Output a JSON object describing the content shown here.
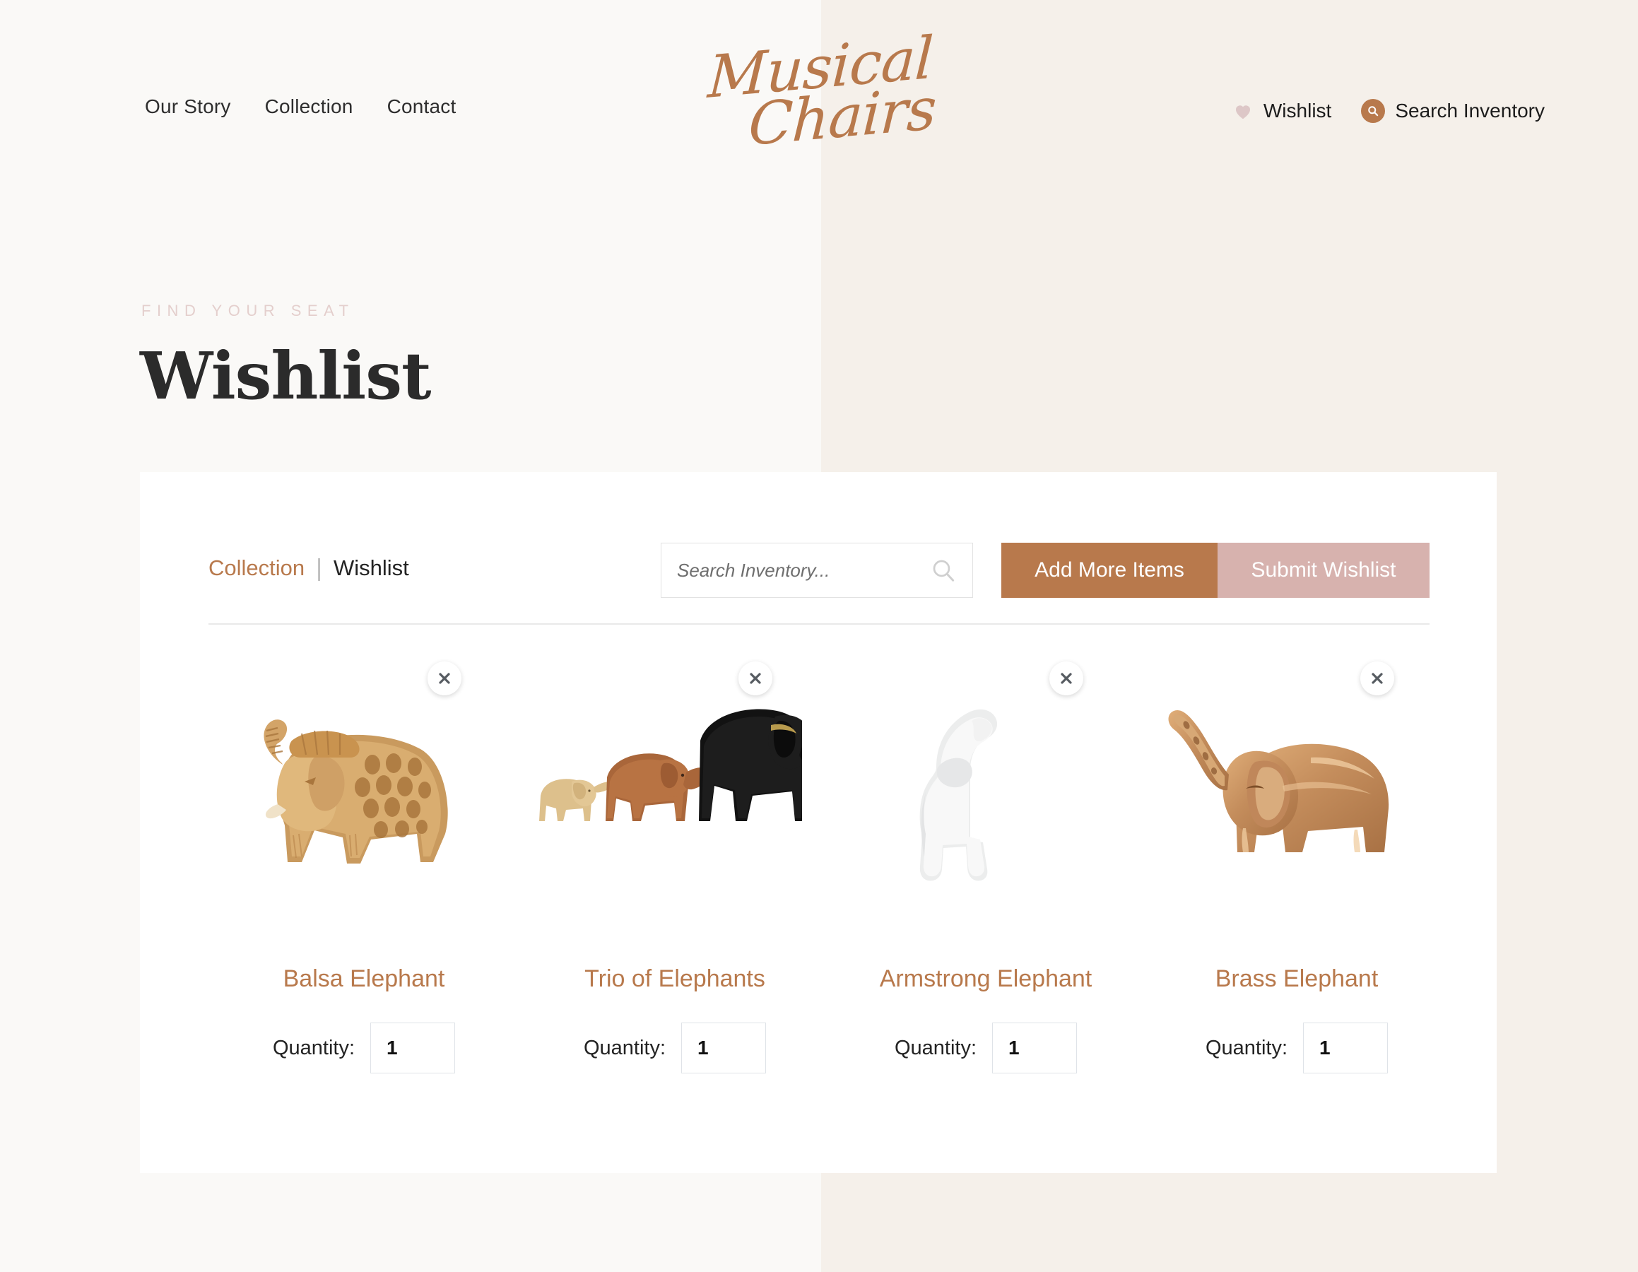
{
  "theme": {
    "bg_left": "#faf9f7",
    "bg_right": "#f5f0ea",
    "accent_tan": "#b8794c",
    "accent_pink": "#d7b2ae",
    "eyebrow_pink": "#e4cfcd",
    "heart_pink": "#ddc7c7",
    "panel_white": "#ffffff",
    "text_dark": "#232323"
  },
  "header": {
    "nav": [
      {
        "label": "Our Story"
      },
      {
        "label": "Collection"
      },
      {
        "label": "Contact"
      }
    ],
    "brand": {
      "line1": "Musical",
      "line2": "Chairs"
    },
    "actions": {
      "wishlist": {
        "label": "Wishlist",
        "icon": "heart-icon"
      },
      "search": {
        "label": "Search Inventory",
        "icon": "search-icon"
      }
    }
  },
  "hero": {
    "eyebrow": "FIND YOUR SEAT",
    "title": "Wishlist"
  },
  "toolbar": {
    "breadcrumb": {
      "parent": "Collection",
      "separator": "|",
      "current": "Wishlist"
    },
    "search": {
      "placeholder": "Search Inventory...",
      "value": "",
      "icon": "search-icon"
    },
    "add_more_label": "Add More Items",
    "submit_label": "Submit Wishlist"
  },
  "products": [
    {
      "name": "Balsa Elephant",
      "quantity_label": "Quantity:",
      "quantity": "1",
      "remove_icon": "close-icon",
      "image": "carved-wooden-elephant-lattice"
    },
    {
      "name": "Trio of Elephants",
      "quantity_label": "Quantity:",
      "quantity": "1",
      "remove_icon": "close-icon",
      "image": "three-wooden-elephants-graduated-sizes"
    },
    {
      "name": "Armstrong Elephant",
      "quantity_label": "Quantity:",
      "quantity": "1",
      "remove_icon": "close-icon",
      "image": "white-ceramic-elephant-raised-trunk"
    },
    {
      "name": "Brass Elephant",
      "quantity_label": "Quantity:",
      "quantity": "1",
      "remove_icon": "close-icon",
      "image": "polished-brass-elephant-raised-trunk"
    }
  ]
}
